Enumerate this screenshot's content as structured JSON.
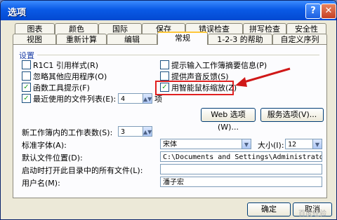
{
  "window": {
    "title": "选项"
  },
  "tabs_row1": [
    "图表",
    "颜色",
    "国际",
    "保存",
    "错误检查",
    "拼写检查",
    "安全性"
  ],
  "tabs_row2": [
    "视图",
    "重新计算",
    "编辑",
    "常规",
    "1-2-3 的帮助",
    "自定义序列"
  ],
  "settings": {
    "group_title": "设置",
    "options": [
      {
        "label": "R1C1 引用样式(R)",
        "checked": false
      },
      {
        "label": "忽略其他应用程序(O)",
        "checked": false
      },
      {
        "label": "函数工具提示(F)",
        "checked": true
      },
      {
        "label": "最近使用的文件列表(E):",
        "checked": true
      },
      {
        "label": "提示输入工作簿摘要信息(P)",
        "checked": false
      },
      {
        "label": "提供声音反馈(S)",
        "checked": false
      },
      {
        "label": "用智能鼠标缩放(Z)",
        "checked": true
      }
    ],
    "recent_files_count": "4",
    "recent_unit": "项",
    "web_options_button": "Web 选项(W)...",
    "service_options_button": "服务选项(V)..."
  },
  "general": {
    "sheets_label": "新工作簿内的工作表数(S):",
    "sheets_value": "3",
    "font_label": "标准字体(A):",
    "font_value": "宋体",
    "size_label": "大小(I):",
    "size_value": "12",
    "default_path_label": "默认文件位置(D):",
    "default_path_value": "C:\\Documents and Settings\\Administrator\\My Do",
    "startup_label": "启动时打开此目录中的所有文件(L):",
    "startup_value": "",
    "username_label": "用户名(M):",
    "username_value": "潘子宏"
  },
  "footer": {
    "ok_button": "确定",
    "cancel_button": "取消",
    "watermark": "百度经验"
  },
  "colors": {
    "highlight": "#e02020",
    "titlebar": "#0a5ae6"
  }
}
